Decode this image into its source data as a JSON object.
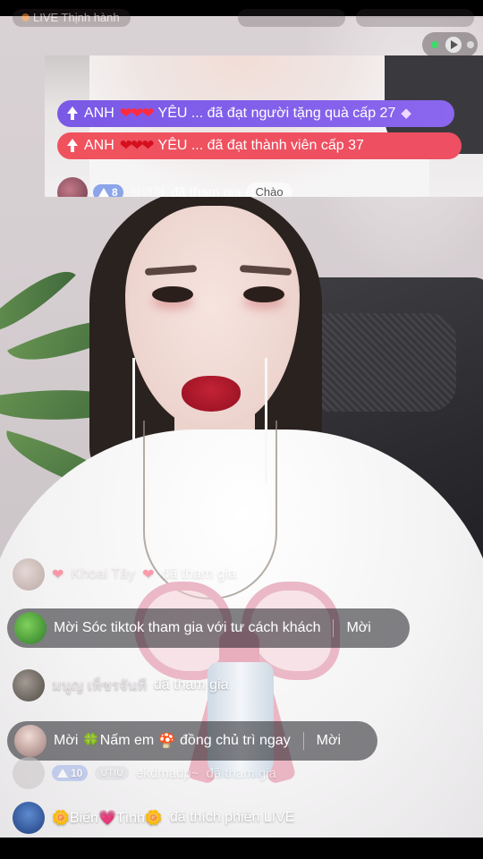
{
  "top": {
    "live_label": "LIVE Thịnh hành",
    "stat_left": "",
    "stat_right": ""
  },
  "banner": {
    "gift_notice": {
      "name": "ANH",
      "hearts": "❤❤❤",
      "rest": "YÊU ... đã đạt người tặng quà cấp 27",
      "icon": "diamond-icon"
    },
    "member_notice": {
      "name": "ANH",
      "hearts": "❤❤❤",
      "rest": "YÊU ... đã đạt thành viên cấp 37",
      "icon": "level-up-icon"
    },
    "join": {
      "level": "8",
      "user": "최영철",
      "text": "đã tham gia",
      "greet_label": "Chào"
    }
  },
  "feed": {
    "row1": {
      "heart_left": "❤",
      "user": "Khoai Tây",
      "heart_right": "❤",
      "text": "đã tham gia"
    },
    "invite1": {
      "text": "Mời Sóc tiktok tham gia với tư cách khách",
      "action": "Mời"
    },
    "row2": {
      "user": "มนูญ เพ็ชรจันที",
      "text": "đã tham gia"
    },
    "invite2": {
      "prefix": "Mời",
      "clover": "🍀",
      "name": "Nấm em",
      "mushroom": "🍄",
      "suffix": "đồng chủ trì ngay",
      "action": "Mời"
    },
    "row3": {
      "level": "10",
      "badge": "UTIU",
      "user": "ekdmadp~",
      "text": "đã tham gia"
    },
    "row4": {
      "flower1": "🌼",
      "name1": "Biển",
      "heart": "💗",
      "name2": "Tình",
      "flower2": "🌼",
      "text": "đã thích phiên LIVE"
    }
  },
  "colors": {
    "gift_banner": "#7a59e6",
    "member_banner": "#f0525d",
    "bubble_bg": "rgba(30,30,34,0.55)"
  }
}
